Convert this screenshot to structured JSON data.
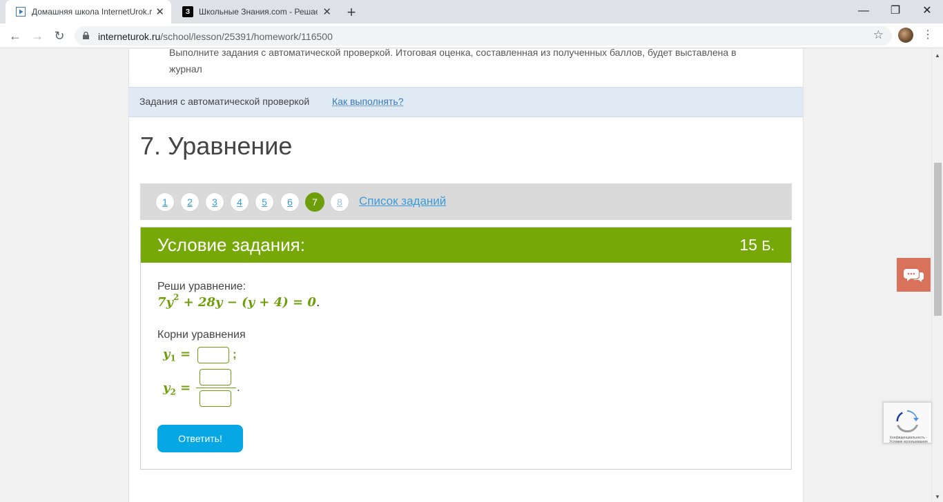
{
  "browser": {
    "tabs": [
      {
        "title": "Домашняя школа InternetUrok.r",
        "active": true,
        "favicon": "play-icon"
      },
      {
        "title": "Школьные Знания.com - Решае",
        "active": false,
        "favicon": "znanija-icon",
        "favicon_text": "З"
      }
    ],
    "url_host": "interneturok.ru",
    "url_path": "/school/lesson/25391/homework/116500"
  },
  "page": {
    "intro_text": "Выполните задания с автоматической проверкой. Итоговая оценка, составленная из полученных баллов, будет выставлена в журнал",
    "infobar": {
      "label": "Задания с автоматической проверкой",
      "link": "Как выполнять?"
    },
    "heading": "7. Уравнение",
    "pager": {
      "pages": [
        "1",
        "2",
        "3",
        "4",
        "5",
        "6",
        "7",
        "8"
      ],
      "current": "7",
      "task_list_link": "Список заданий"
    },
    "task": {
      "header_title": "Условие задания:",
      "points": "15",
      "points_unit": "Б.",
      "question": "Реши уравнение:",
      "equation": {
        "a": "7y",
        "exp": "2",
        "rest": " + 28y − (y + 4) = 0",
        "end": "."
      },
      "roots_label": "Корни уравнения",
      "y1_var": "y",
      "y1_sub": "1",
      "y2_var": "y",
      "y2_sub": "2",
      "equals": " =",
      "semicolon": ";",
      "period": ".",
      "submit_label": "Ответить!"
    }
  },
  "recaptcha": {
    "text": "Конфиденциальность - Условия использования"
  },
  "colors": {
    "accent_green": "#76a808",
    "button_blue": "#06a7e2",
    "chat": "#d9725a"
  }
}
